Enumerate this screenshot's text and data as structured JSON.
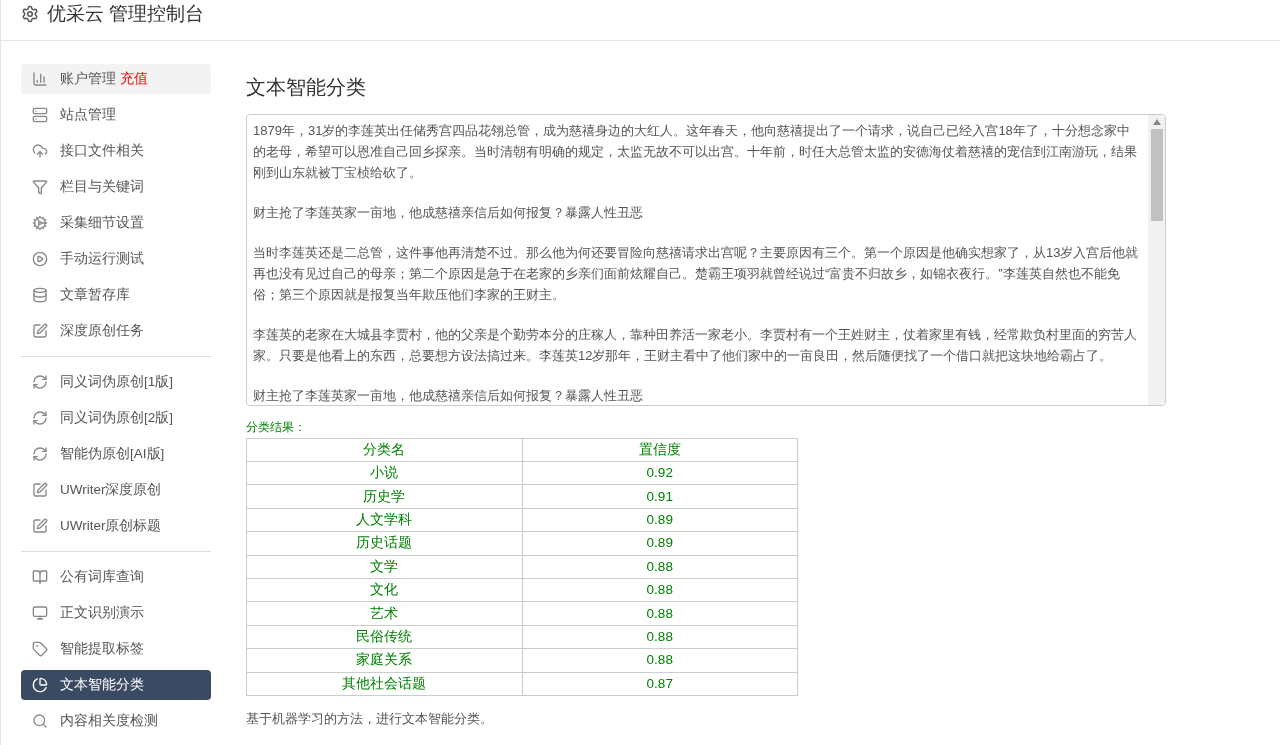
{
  "header": {
    "title": "优采云 管理控制台"
  },
  "sidebar": {
    "groups": [
      {
        "items": [
          {
            "label": "账户管理",
            "badge": "充值",
            "selected": false,
            "highlighted": true
          },
          {
            "label": "站点管理",
            "selected": false,
            "highlighted": false
          },
          {
            "label": "接口文件相关",
            "selected": false,
            "highlighted": false
          },
          {
            "label": "栏目与关键词",
            "selected": false,
            "highlighted": false
          },
          {
            "label": "采集细节设置",
            "selected": false,
            "highlighted": false
          },
          {
            "label": "手动运行测试",
            "selected": false,
            "highlighted": false
          },
          {
            "label": "文章暂存库",
            "selected": false,
            "highlighted": false
          },
          {
            "label": "深度原创任务",
            "selected": false,
            "highlighted": false
          }
        ]
      },
      {
        "items": [
          {
            "label": "同义词伪原创[1版]",
            "selected": false,
            "highlighted": false
          },
          {
            "label": "同义词伪原创[2版]",
            "selected": false,
            "highlighted": false
          },
          {
            "label": "智能伪原创[AI版]",
            "selected": false,
            "highlighted": false
          },
          {
            "label": "UWriter深度原创",
            "selected": false,
            "highlighted": false
          },
          {
            "label": "UWriter原创标题",
            "selected": false,
            "highlighted": false
          }
        ]
      },
      {
        "items": [
          {
            "label": "公有词库查询",
            "selected": false,
            "highlighted": false
          },
          {
            "label": "正文识别演示",
            "selected": false,
            "highlighted": false
          },
          {
            "label": "智能提取标签",
            "selected": false,
            "highlighted": false
          },
          {
            "label": "文本智能分类",
            "selected": true,
            "highlighted": false
          },
          {
            "label": "内容相关度检测",
            "selected": false,
            "highlighted": false
          }
        ]
      }
    ]
  },
  "main": {
    "title": "文本智能分类",
    "input_text": [
      "1879年，31岁的李莲英出任储秀宫四品花翎总管，成为慈禧身边的大红人。这年春天，他向慈禧提出了一个请求，说自己已经入宫18年了，十分想念家中的老母，希望可以恩准自己回乡探亲。当时清朝有明确的规定，太监无故不可以出宫。十年前，时任大总管太监的安德海仗着慈禧的宠信到江南游玩，结果刚到山东就被丁宝桢给砍了。",
      "财主抢了李莲英家一亩地，他成慈禧亲信后如何报复？暴露人性丑恶",
      "当时李莲英还是二总管，这件事他再清楚不过。那么他为何还要冒险向慈禧请求出宫呢？主要原因有三个。第一个原因是他确实想家了，从13岁入宫后他就再也没有见过自己的母亲；第二个原因是急于在老家的乡亲们面前炫耀自己。楚霸王项羽就曾经说过“富贵不归故乡，如锦衣夜行。”李莲英自然也不能免俗；第三个原因就是报复当年欺压他们李家的王财主。",
      "李莲英的老家在大城县李贾村，他的父亲是个勤劳本分的庄稼人，靠种田养活一家老小。李贾村有一个王姓财主，仗着家里有钱，经常欺负村里面的穷苦人家。只要是他看上的东西，总要想方设法搞过来。李莲英12岁那年，王财主看中了他们家中的一亩良田，然后随便找了一个借口就把这块地给霸占了。",
      "财主抢了李莲英家一亩地，他成慈禧亲信后如何报复？暴露人性丑恶"
    ],
    "result_label": "分类结果：",
    "table": {
      "columns": [
        "分类名",
        "置信度"
      ],
      "rows": [
        [
          "小说",
          "0.92"
        ],
        [
          "历史学",
          "0.91"
        ],
        [
          "人文学科",
          "0.89"
        ],
        [
          "历史话题",
          "0.89"
        ],
        [
          "文学",
          "0.88"
        ],
        [
          "文化",
          "0.88"
        ],
        [
          "艺术",
          "0.88"
        ],
        [
          "民俗传统",
          "0.88"
        ],
        [
          "家庭关系",
          "0.88"
        ],
        [
          "其他社会话题",
          "0.87"
        ]
      ]
    },
    "note": "基于机器学习的方法，进行文本智能分类。"
  }
}
